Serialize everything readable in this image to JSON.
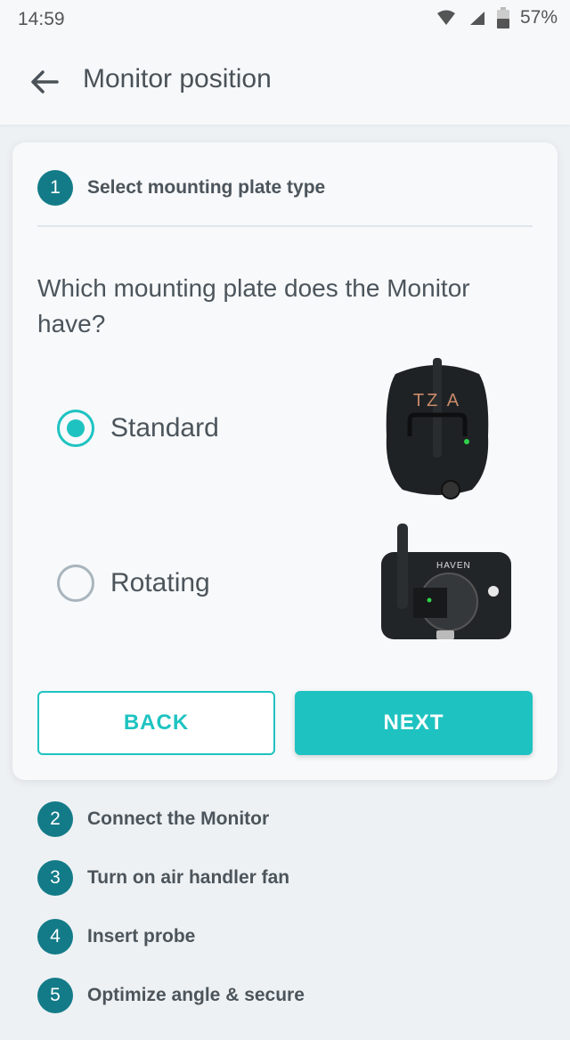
{
  "status": {
    "time": "14:59",
    "battery": "57%"
  },
  "appbar": {
    "title": "Monitor position"
  },
  "current_step": {
    "number": "1",
    "title": "Select mounting plate type"
  },
  "question": "Which mounting plate does the Monitor have?",
  "options": [
    {
      "label": "Standard",
      "selected": true,
      "brand": "TZOA"
    },
    {
      "label": "Rotating",
      "selected": false,
      "brand": "HAVEN"
    }
  ],
  "buttons": {
    "back": "BACK",
    "next": "NEXT"
  },
  "steps": [
    {
      "number": "2",
      "title": "Connect the Monitor"
    },
    {
      "number": "3",
      "title": "Turn on air handler fan"
    },
    {
      "number": "4",
      "title": "Insert probe"
    },
    {
      "number": "5",
      "title": "Optimize angle & secure"
    }
  ],
  "colors": {
    "teal": "#137b88",
    "accent": "#1ec3c1"
  }
}
